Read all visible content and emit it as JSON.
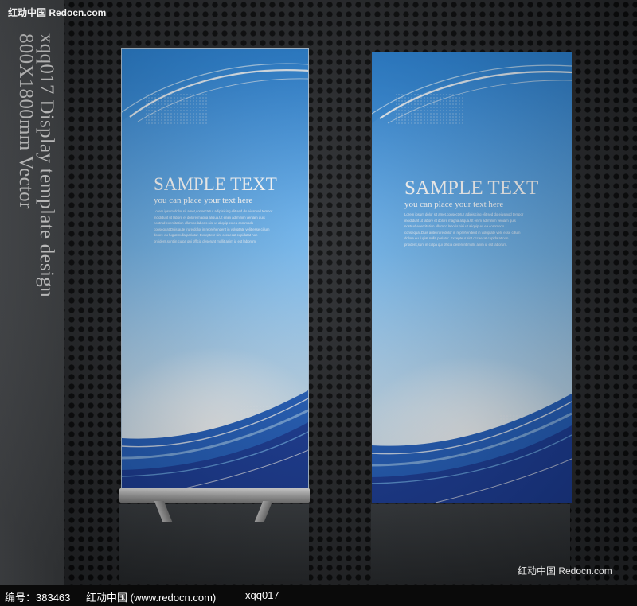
{
  "watermark": {
    "top": "红动中国 Redocn.com",
    "bottom_right": "红动中国 Redocn.com"
  },
  "side_caption": {
    "line1": "xqq017 Display template design",
    "line2": "800X1800mm Vector"
  },
  "banners": [
    {
      "title": "SAMPLE TEXT",
      "subtitle": "you can place your text here",
      "body": [
        "Lorem ipsum dolor sit amet,consectetur adipisicing elit,sed do eiusmod tempor",
        "incididunt ut labore et dolore magna aliqua.Ut enim ad minim veniam quis",
        "nostrud exercitation ullamco laboris nisi ut aliquip ex ea commodo",
        "consequat.Duis aute irure dolor in reprehenderit in voluptate velit esse cillum",
        "dolore eu fugiat nulla pariatur. Excepteur sint occaecat cupidatat non",
        "proident,sunt in culpa qui officia deserunt mollit anim id est laborum."
      ]
    },
    {
      "title": "SAMPLE TEXT",
      "subtitle": "you can place your text here",
      "body": [
        "Lorem ipsum dolor sit amet,consectetur adipisicing elit,sed do eiusmod tempor",
        "incididunt ut labore et dolore magna aliqua.Ut enim ad minim veniam quis",
        "nostrud exercitation ullamco laboris nisi ut aliquip ex ea commodo",
        "consequat.Duis aute irure dolor in reprehenderit in voluptate velit esse cillum",
        "dolore eu fugiat nulla pariatur. Excepteur sint occaecat cupidatat non",
        "proident,sunt in culpa qui officia deserunt mollit anim id est laborum."
      ]
    }
  ],
  "footer": {
    "code": "编号：383463",
    "site": "红动中国 (www.redocn.com)",
    "author": "xqq017"
  },
  "colors": {
    "banner_blue": "#2f8fe0",
    "wave_dark": "#1c3f9e",
    "background": "#2a2c2f"
  }
}
